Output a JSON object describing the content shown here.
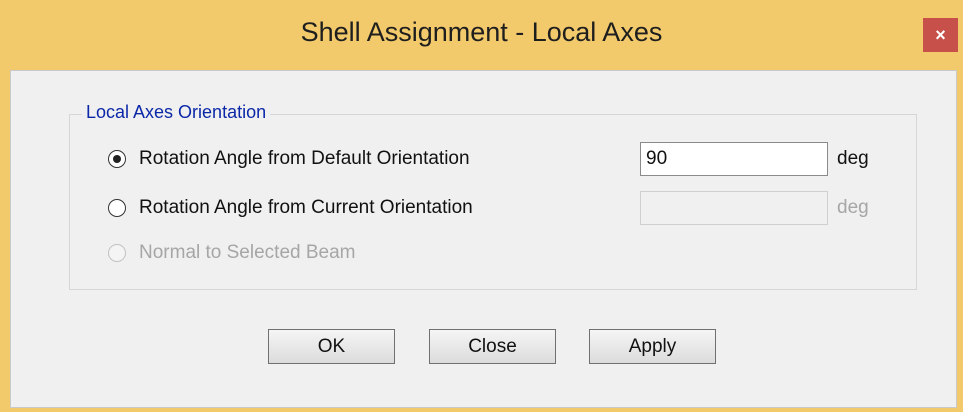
{
  "window": {
    "title": "Shell Assignment - Local Axes",
    "close_glyph": "×",
    "accent_color": "#f2c96b",
    "close_color": "#c7504a"
  },
  "group": {
    "legend": "Local Axes Orientation",
    "legend_color": "#0b28a8"
  },
  "options": [
    {
      "label": "Rotation Angle from Default Orientation",
      "selected": true,
      "enabled": true
    },
    {
      "label": "Rotation Angle from Current Orientation",
      "selected": false,
      "enabled": true
    },
    {
      "label": "Normal to Selected Beam",
      "selected": false,
      "enabled": false
    }
  ],
  "fields": {
    "default_angle": {
      "value": "90",
      "unit": "deg"
    },
    "current_angle": {
      "value": "",
      "unit": "deg"
    }
  },
  "buttons": {
    "ok": "OK",
    "close": "Close",
    "apply": "Apply"
  }
}
